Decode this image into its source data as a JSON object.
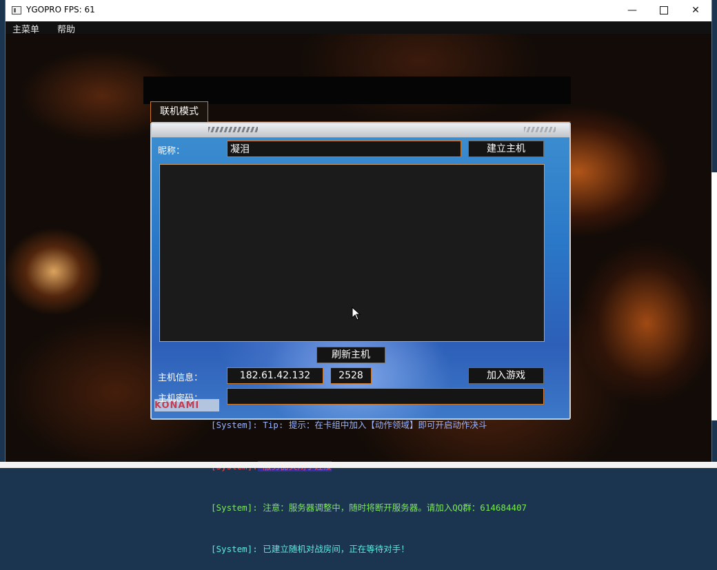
{
  "window": {
    "title": "YGOPRO FPS: 61",
    "minimize": "—",
    "close": "✕"
  },
  "menu": {
    "items": [
      "主菜单",
      "帮助"
    ]
  },
  "dialog": {
    "tab_label": "联机模式",
    "nickname_label": "昵称：",
    "nickname_value": "凝泪",
    "create_host_button": "建立主机",
    "refresh_button": "刷新主机",
    "host_info_label": "主机信息：",
    "host_ip": "182.61.42.132",
    "host_port": "2528",
    "join_button": "加入游戏",
    "host_password_label": "主机密码：",
    "password_value": "",
    "watermark": "KONAMI"
  },
  "log": [
    {
      "tag": "[System]:",
      "text": " Tip: 提示：在卡组中加入【动作领域】即可开启动作决斗"
    },
    {
      "tag": "[System]:",
      "text": " 服务器关闭了连接"
    },
    {
      "tag": "[System]:",
      "text": " 注意：服务器调整中，随时将断开服务器。请加入QQ群：614684407"
    },
    {
      "tag": "[System]:",
      "text": " 已建立随机对战房间，正在等待对手！"
    }
  ],
  "colors": {
    "accent_orange": "#d07a2c",
    "panel_blue": "#2a78c8",
    "log_tip": "#9ab4ff",
    "log_error": "#ff4646",
    "log_notice": "#7ee85a",
    "log_info": "#62e6e0"
  }
}
